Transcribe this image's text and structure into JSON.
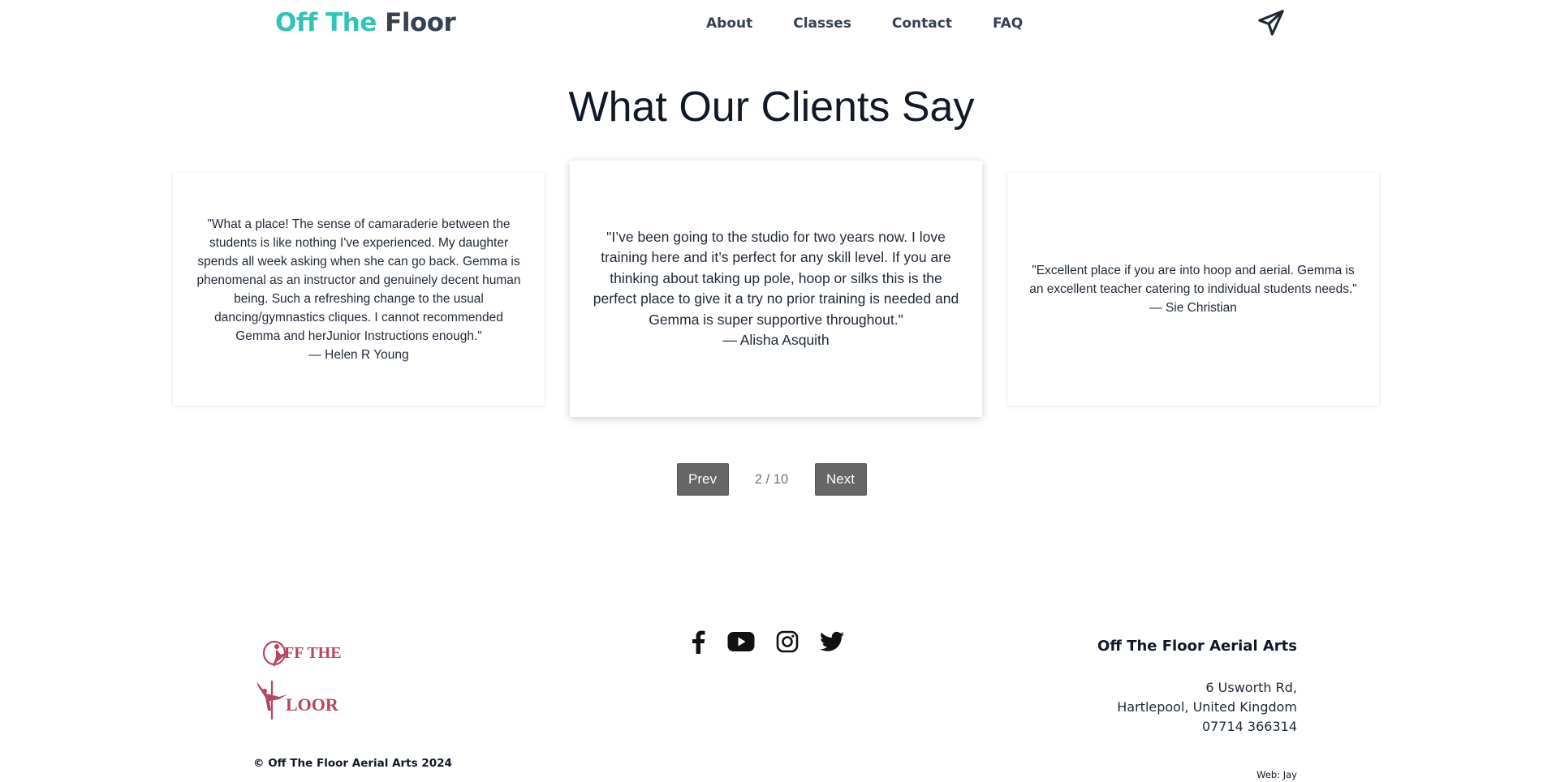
{
  "header": {
    "brand_accent": "Off The",
    "brand_rest": "Floor",
    "nav": [
      "About",
      "Classes",
      "Contact",
      "FAQ"
    ],
    "contact_icon": "paper-plane-icon"
  },
  "main": {
    "title": "What Our Clients Say",
    "testimonials": [
      {
        "quote": "\"What a place! The sense of camaraderie between the students is like nothing I've experienced. My daughter spends all week asking when she can go back. Gemma is phenomenal as an instructor and genuinely decent human being. Such a refreshing change to the usual dancing/gymnastics cliques. I cannot recommended Gemma and herJunior Instructions enough.\"",
        "author": "— Helen R Young"
      },
      {
        "quote": "\"I’ve been going to the studio for two years now. I love training here and it’s perfect for any skill level. If you are thinking about taking up pole, hoop or silks this is the perfect place to give it a try no prior training is needed and Gemma is super supportive throughout.\"",
        "author": "— Alisha Asquith"
      },
      {
        "quote": "\"Excellent place if you are into hoop and aerial. Gemma is an excellent teacher catering to individual students needs.\"",
        "author": "— Sie Christian"
      }
    ],
    "pager": {
      "prev_label": "Prev",
      "next_label": "Next",
      "indicator": "2 / 10"
    }
  },
  "footer": {
    "logo_text_top": "FF THE",
    "logo_text_bottom": "LOOR",
    "socials": [
      "facebook-icon",
      "youtube-icon",
      "instagram-icon",
      "twitter-icon"
    ],
    "company": "Off The Floor Aerial Arts",
    "address_line1": "6 Usworth Rd,",
    "address_line2": "Hartlepool, United Kingdom",
    "phone": "07714 366314",
    "copyright": "© Off The Floor Aerial Arts 2024",
    "credit": "Web: Jay"
  },
  "colors": {
    "brand_accent": "#2ec4b6",
    "logo": "#b5475f",
    "button_bg": "#666666"
  }
}
